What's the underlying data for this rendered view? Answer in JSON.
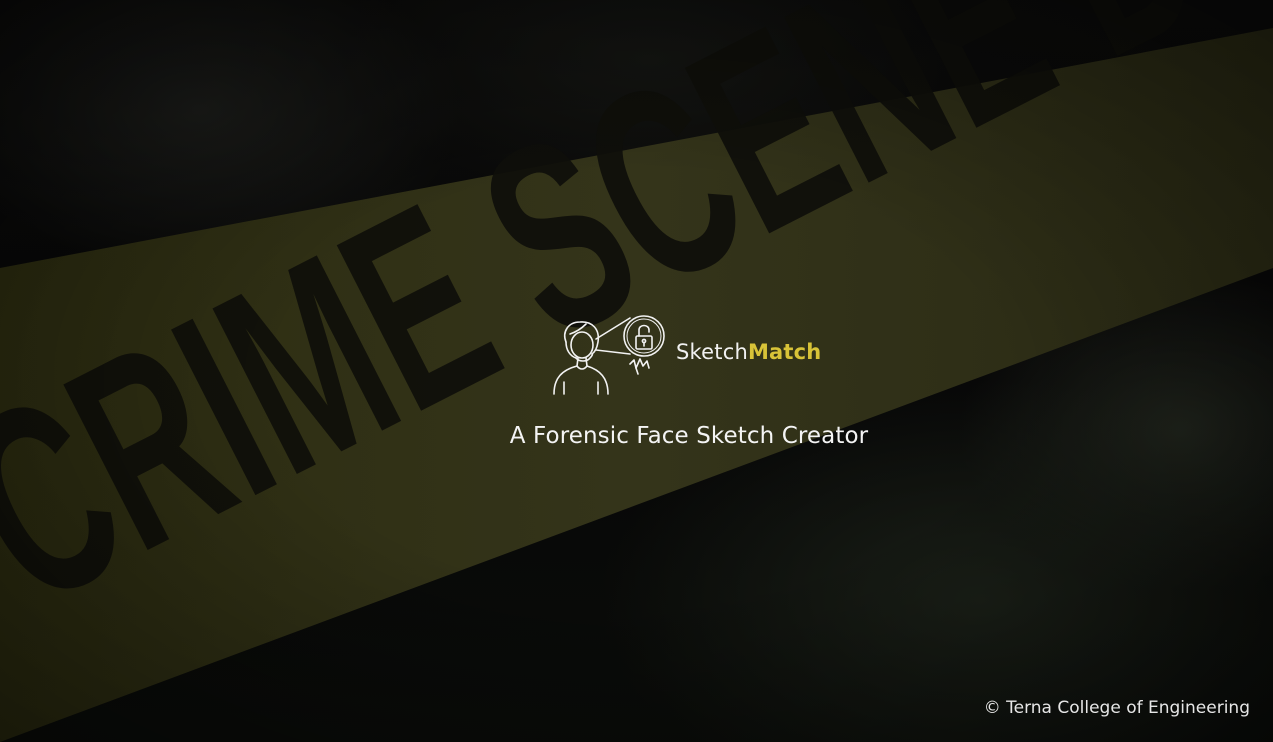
{
  "brand": {
    "name_first": "Sketch",
    "name_second": "Match",
    "accent_color": "#d8c338",
    "logo_icon": "person-with-lock-icon"
  },
  "tagline": "A Forensic Face Sketch Creator",
  "background": {
    "tape_text": "CRIME SCENE DO NOT",
    "tape_color": "#3a3a14"
  },
  "footer": {
    "copyright": "© Terna College of Engineering"
  }
}
